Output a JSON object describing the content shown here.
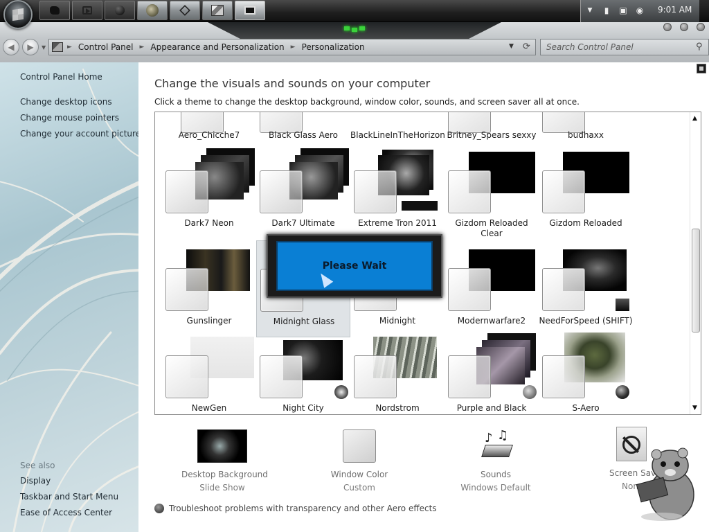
{
  "taskbar": {
    "clock": "9:01 AM",
    "buttons": [
      "app-blob",
      "media-player",
      "app-ball",
      "gaming",
      "app-cube",
      "control-panel",
      "desktop"
    ]
  },
  "address_bar": {
    "crumbs": [
      "Control Panel",
      "Appearance and Personalization",
      "Personalization"
    ]
  },
  "search": {
    "placeholder": "Search Control Panel"
  },
  "left_pane": {
    "home": "Control Panel Home",
    "links": [
      "Change desktop icons",
      "Change mouse pointers",
      "Change your account picture"
    ],
    "see_also": "See also",
    "see_also_links": [
      "Display",
      "Taskbar and Start Menu",
      "Ease of Access Center"
    ]
  },
  "main": {
    "title": "Change the visuals and sounds on your computer",
    "subtitle": "Click a theme to change the desktop background, window color, sounds, and screen saver all at once."
  },
  "themes": [
    "Aero_Chicche7",
    "Black Glass Aero",
    "BlackLineInTheHorizon",
    "Britney_Spears sexxy",
    "budhaxx",
    "Dark7 Neon",
    "Dark7 Ultimate",
    "Extreme Tron 2011",
    "Gizdom Reloaded Clear",
    "Gizdom Reloaded",
    "Gunslinger",
    "Midnight Glass",
    "Midnight",
    "Modernwarfare2",
    "NeedForSpeed (SHIFT)",
    "NewGen",
    "Night City",
    "Nordstrom",
    "Purple and Black",
    "S-Aero"
  ],
  "selected_theme": "Midnight Glass",
  "dialog": {
    "text": "Please Wait"
  },
  "bottom": {
    "desktop_background": {
      "title": "Desktop Background",
      "value": "Slide Show"
    },
    "window_color": {
      "title": "Window Color",
      "value": "Custom"
    },
    "sounds": {
      "title": "Sounds",
      "value": "Windows Default"
    },
    "screen_saver": {
      "title": "Screen Saver",
      "value": "None"
    }
  },
  "troubleshoot": "Troubleshoot problems with transparency and other Aero effects",
  "colors": {
    "dialog_blue": "#0a7fd4",
    "accent_green": "#3bd23b"
  }
}
